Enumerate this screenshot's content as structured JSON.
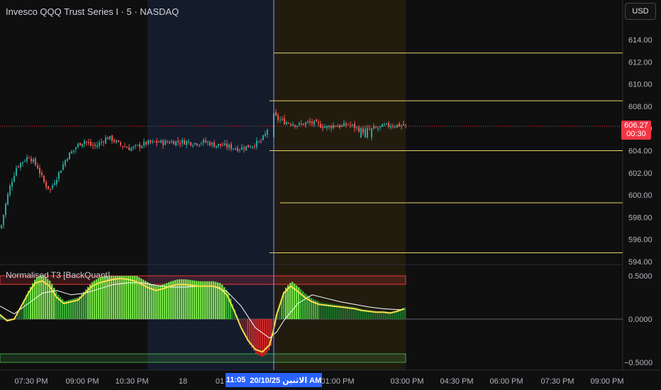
{
  "header": {
    "title": "Invesco QQQ Trust Series I · 5 · NASDAQ",
    "currency_button": "USD"
  },
  "indicator": {
    "title": "Normalised T3 [BackQuant]",
    "levels": [
      "0.5000",
      "0.0000",
      "−0.5000"
    ]
  },
  "price_axis": {
    "ticks": [
      "614.00",
      "612.00",
      "610.00",
      "608.00",
      "606.00",
      "604.00",
      "602.00",
      "600.00",
      "598.00",
      "596.00",
      "594.00"
    ],
    "range": [
      593.8,
      615.6
    ]
  },
  "current_price": {
    "value": "606.27",
    "countdown": "00:30"
  },
  "time_axis": {
    "ticks": [
      "07:30 PM",
      "09:00 PM",
      "10:30 PM",
      "18",
      "01",
      "01:00 PM",
      "03:00 PM",
      "04:30 PM",
      "06:00 PM",
      "07:30 PM",
      "09:00 PM"
    ],
    "crosshair_time": "11:05",
    "crosshair_date": "20/10/25 الاثنين AM"
  },
  "horizontal_levels": [
    612.8,
    608.5,
    604.0,
    599.3,
    594.8
  ],
  "colors": {
    "background": "#0f0f0f",
    "up_candle": "#26a69a",
    "down_candle": "#ef5350",
    "level_line": "#e8d66a",
    "session_highlight_blue": "#141c2e",
    "session_highlight_orange": "#241d0f",
    "crosshair": "#7f9bff",
    "price_badge": "#f23645",
    "t3_line": "#f5e04b",
    "signal_line": "#ffffff"
  },
  "chart_data": {
    "type": "candlestick",
    "symbol": "QQQ",
    "interval": "5",
    "close_path_x": [
      0,
      8,
      14,
      22,
      30,
      40,
      52,
      62,
      70,
      78,
      86,
      94,
      102,
      110,
      118,
      126,
      134,
      142,
      150,
      158,
      166,
      174,
      182,
      190,
      198,
      206,
      214,
      222,
      230,
      238,
      246,
      254,
      262,
      270,
      278,
      286,
      294,
      302,
      310,
      318,
      326,
      334,
      342,
      350,
      358,
      366,
      374,
      380,
      384,
      390,
      400,
      410,
      420,
      430,
      440,
      450,
      460,
      470,
      480,
      490,
      500,
      510,
      520,
      530,
      540,
      550,
      560,
      566,
      572
    ],
    "close_path_y": [
      597.0,
      599.5,
      601.0,
      602.5,
      603.0,
      603.5,
      602.5,
      601.0,
      600.5,
      601.5,
      602.5,
      603.5,
      604.0,
      604.6,
      604.9,
      604.5,
      604.4,
      604.8,
      605.2,
      605.0,
      604.6,
      604.4,
      604.2,
      604.3,
      604.5,
      604.7,
      604.7,
      604.8,
      604.7,
      604.8,
      604.8,
      604.8,
      604.8,
      604.7,
      604.7,
      604.8,
      604.7,
      604.5,
      604.5,
      604.4,
      604.3,
      604.2,
      604.3,
      604.4,
      604.6,
      604.8,
      605.5,
      606.8,
      607.2,
      606.9,
      606.6,
      606.5,
      606.3,
      606.5,
      606.5,
      606.3,
      606.1,
      606.3,
      606.2,
      606.4,
      606.1,
      605.8,
      605.9,
      606.0,
      606.2,
      606.3,
      606.3,
      606.3,
      606.27
    ],
    "current_price": 606.27,
    "horizontal_levels": [
      612.8,
      608.5,
      604.0,
      599.3,
      594.8
    ],
    "indicator": {
      "name": "Normalised T3 [BackQuant]",
      "ylim": [
        -0.55,
        0.55
      ],
      "levels": [
        0.5,
        0.4,
        0.0,
        -0.4,
        -0.5
      ],
      "t3_x": [
        0,
        10,
        20,
        30,
        40,
        50,
        60,
        70,
        80,
        90,
        100,
        110,
        120,
        130,
        140,
        150,
        160,
        170,
        180,
        190,
        200,
        210,
        220,
        230,
        240,
        250,
        260,
        270,
        280,
        290,
        300,
        310,
        320,
        330,
        340,
        350,
        360,
        370,
        380,
        385,
        390,
        400,
        410,
        420,
        430,
        440,
        450,
        460,
        470,
        480,
        490,
        500,
        510,
        520,
        530,
        540,
        550,
        560,
        570
      ],
      "t3_y": [
        0.05,
        -0.02,
        0.0,
        0.15,
        0.3,
        0.42,
        0.44,
        0.38,
        0.25,
        0.18,
        0.2,
        0.22,
        0.3,
        0.38,
        0.42,
        0.44,
        0.46,
        0.47,
        0.46,
        0.44,
        0.4,
        0.36,
        0.33,
        0.35,
        0.38,
        0.4,
        0.4,
        0.39,
        0.38,
        0.38,
        0.38,
        0.36,
        0.28,
        0.1,
        -0.1,
        -0.25,
        -0.35,
        -0.38,
        -0.3,
        -0.15,
        0.05,
        0.3,
        0.38,
        0.32,
        0.25,
        0.2,
        0.17,
        0.16,
        0.15,
        0.14,
        0.13,
        0.12,
        0.1,
        0.09,
        0.08,
        0.08,
        0.07,
        0.09,
        0.12
      ],
      "signal_x": [
        0,
        20,
        40,
        60,
        80,
        100,
        120,
        140,
        160,
        180,
        200,
        220,
        240,
        260,
        280,
        300,
        320,
        340,
        360,
        380,
        390,
        400,
        420,
        440,
        460,
        480,
        500,
        520,
        540,
        560,
        570
      ],
      "signal_y": [
        0.15,
        0.06,
        0.18,
        0.3,
        0.33,
        0.28,
        0.3,
        0.35,
        0.4,
        0.42,
        0.42,
        0.39,
        0.37,
        0.37,
        0.38,
        0.38,
        0.32,
        0.15,
        -0.1,
        -0.22,
        -0.15,
        -0.02,
        0.18,
        0.28,
        0.24,
        0.2,
        0.17,
        0.14,
        0.12,
        0.11,
        0.11
      ]
    }
  }
}
